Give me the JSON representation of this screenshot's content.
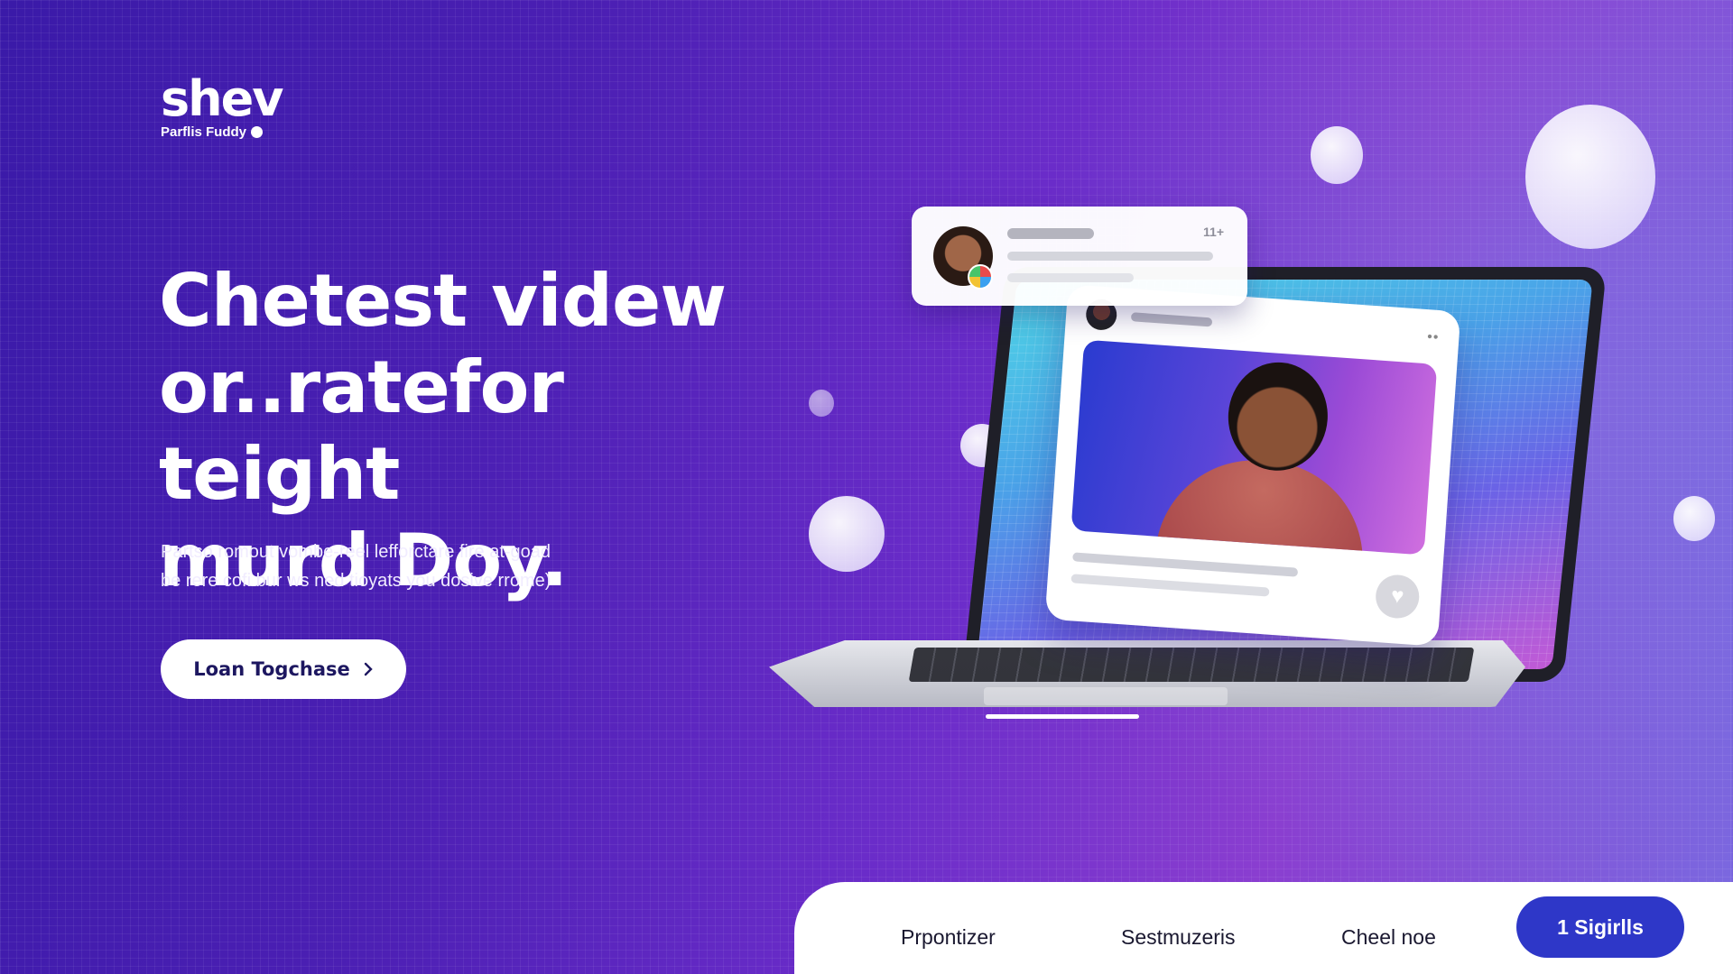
{
  "brand": {
    "logo_text": "shev",
    "tagline": "Parflis Fuddy"
  },
  "hero": {
    "headline_lines": [
      "Chetest videw",
      "or..ratefor teight",
      "murd Doy."
    ],
    "subtext_lines": [
      "Partso romout vombe-reel lefforctare fire at-goad",
      "be rere cofi bur ws ned tioyats you dosive rrome)"
    ],
    "cta_label": "Loan Togchase",
    "cta_icon": "chevron-right-icon"
  },
  "notification_card": {
    "meta": "11+"
  },
  "post_card": {
    "menu": "••",
    "like_icon": "heart-icon"
  },
  "bottom_nav": {
    "items": [
      "Prpontizer",
      "Sestmuzeris",
      "Cheel noe"
    ],
    "cta_label": "1 Sigirlls"
  },
  "colors": {
    "background_start": "#3a1aa8",
    "background_end": "#8a3ed0",
    "nav_cta": "#2e37c8",
    "cta_text": "#1d1760"
  }
}
